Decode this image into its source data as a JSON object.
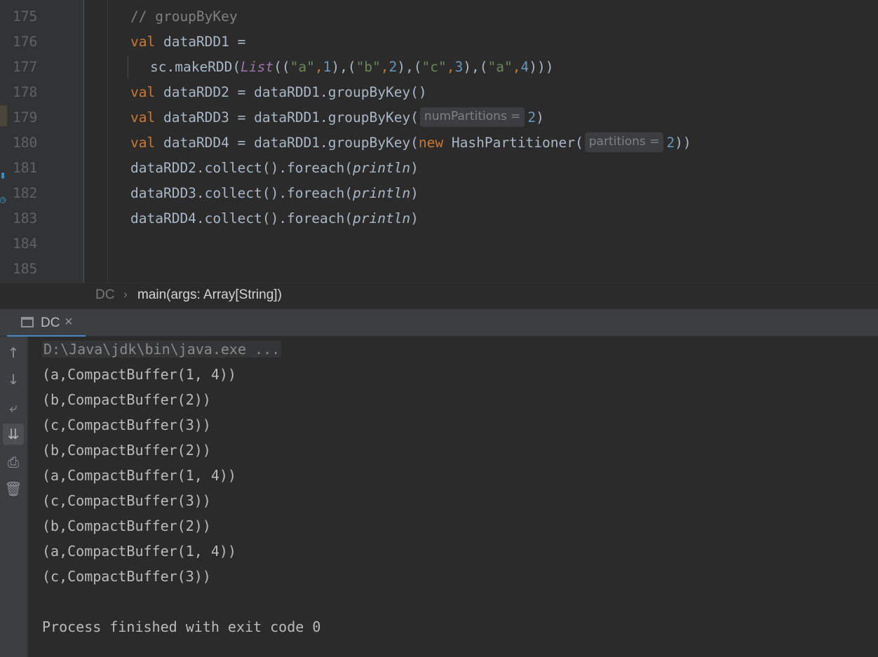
{
  "editor": {
    "lines": [
      {
        "num": "175"
      },
      {
        "num": "176"
      },
      {
        "num": "177"
      },
      {
        "num": "178"
      },
      {
        "num": "179"
      },
      {
        "num": "180"
      },
      {
        "num": "181"
      },
      {
        "num": "182"
      },
      {
        "num": "183"
      },
      {
        "num": "184"
      },
      {
        "num": "185"
      }
    ],
    "code": {
      "l175_comment": "// groupByKey",
      "l176_kw": "val",
      "l176_rest": " dataRDD1 =",
      "l177_a": "sc.makeRDD(",
      "l177_list": "List",
      "l177_b": "((",
      "l177_sa": "\"a\"",
      "l177_c1": ",",
      "l177_n1": "1",
      "l177_d": "),(",
      "l177_sb": "\"b\"",
      "l177_c2": ",",
      "l177_n2": "2",
      "l177_e": "),(",
      "l177_sc": "\"c\"",
      "l177_c3": ",",
      "l177_n3": "3",
      "l177_f": "),(",
      "l177_sa2": "\"a\"",
      "l177_c4": ",",
      "l177_n4": "4",
      "l177_g": ")))",
      "l178_kw": "val",
      "l178_rest": " dataRDD2 = dataRDD1.groupByKey()",
      "l179_kw": "val",
      "l179_rest": " dataRDD3 = dataRDD1.groupByKey(",
      "l179_hint": "numPartitions =",
      "l179_num": "2",
      "l179_end": ")",
      "l180_kw": "val",
      "l180_rest": " dataRDD4 = dataRDD1.groupByKey(",
      "l180_new": "new",
      "l180_cls": " HashPartitioner(",
      "l180_hint": "partitions =",
      "l180_num": "2",
      "l180_end": "))",
      "l181_a": "dataRDD2.collect().foreach(",
      "l181_fn": "println",
      "l181_b": ")",
      "l182_a": "dataRDD3.collect().foreach(",
      "l182_fn": "println",
      "l182_b": ")",
      "l183_a": "dataRDD4.collect().foreach(",
      "l183_fn": "println",
      "l183_b": ")"
    }
  },
  "breadcrumb": {
    "object": "DC",
    "separator": "›",
    "method": "main(args: Array[String])"
  },
  "run_panel": {
    "tab_label": "DC",
    "tab_close": "×",
    "toolbar_icons": [
      "arrow-up-icon",
      "arrow-down-icon",
      "soft-wrap-icon",
      "scroll-to-end-icon",
      "print-icon",
      "trash-icon"
    ],
    "command": "D:\\Java\\jdk\\bin\\java.exe ...",
    "output": [
      "(a,CompactBuffer(1, 4))",
      "(b,CompactBuffer(2))",
      "(c,CompactBuffer(3))",
      "(b,CompactBuffer(2))",
      "(a,CompactBuffer(1, 4))",
      "(c,CompactBuffer(3))",
      "(b,CompactBuffer(2))",
      "(a,CompactBuffer(1, 4))",
      "(c,CompactBuffer(3))"
    ],
    "exit_message": "Process finished with exit code 0"
  },
  "colors": {
    "background": "#2b2b2b",
    "keyword": "#cc7832",
    "string": "#6a8759",
    "number": "#6897bb",
    "comment": "#808080",
    "accent": "#4a88c7"
  }
}
